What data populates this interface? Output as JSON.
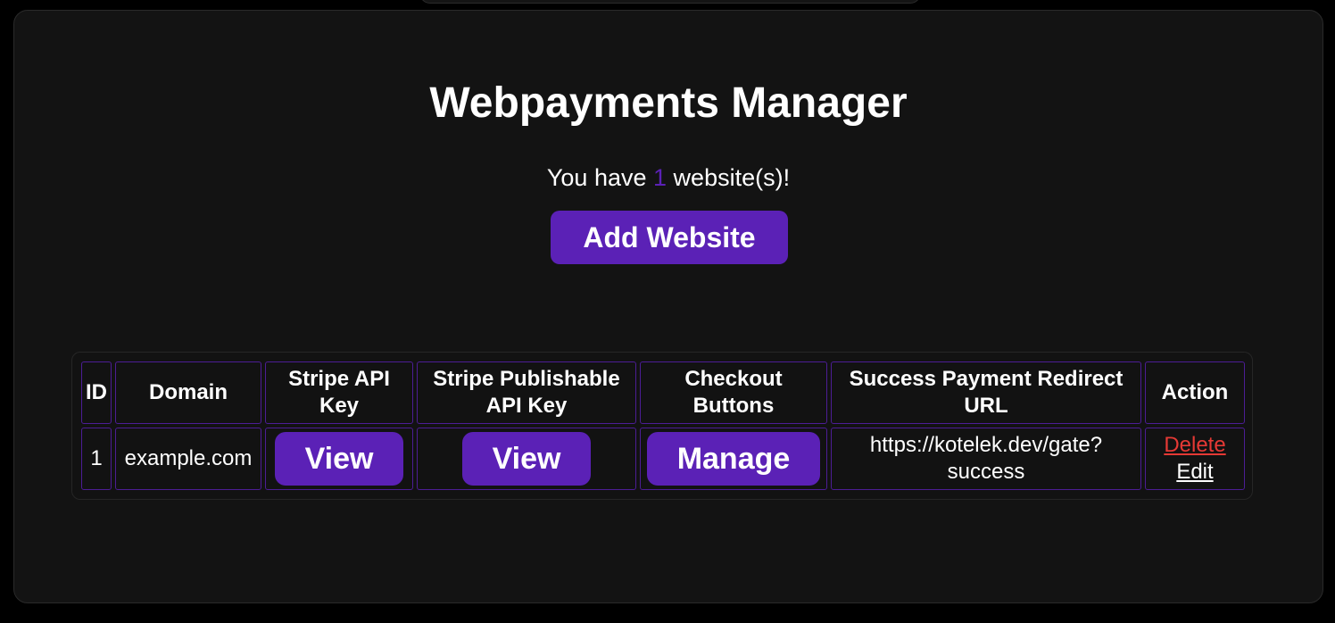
{
  "page": {
    "title": "Webpayments Manager",
    "count_prefix": "You have ",
    "count_value": "1",
    "count_suffix": " website(s)!",
    "add_button_label": "Add Website"
  },
  "table": {
    "headers": {
      "id": "ID",
      "domain": "Domain",
      "stripe_key": "Stripe API Key",
      "publishable_key": "Stripe Publishable API Key",
      "checkout": "Checkout Buttons",
      "redirect": "Success Payment Redirect URL",
      "action": "Action"
    },
    "rows": [
      {
        "id": "1",
        "domain": "example.com",
        "stripe_key_button": "View",
        "publishable_key_button": "View",
        "checkout_button": "Manage",
        "redirect_url": "https://kotelek.dev/gate?success",
        "delete_label": "Delete",
        "edit_label": "Edit"
      }
    ]
  },
  "colors": {
    "accent": "#5b21b6",
    "danger": "#e53935",
    "panel": "#131313",
    "background": "#000000"
  }
}
